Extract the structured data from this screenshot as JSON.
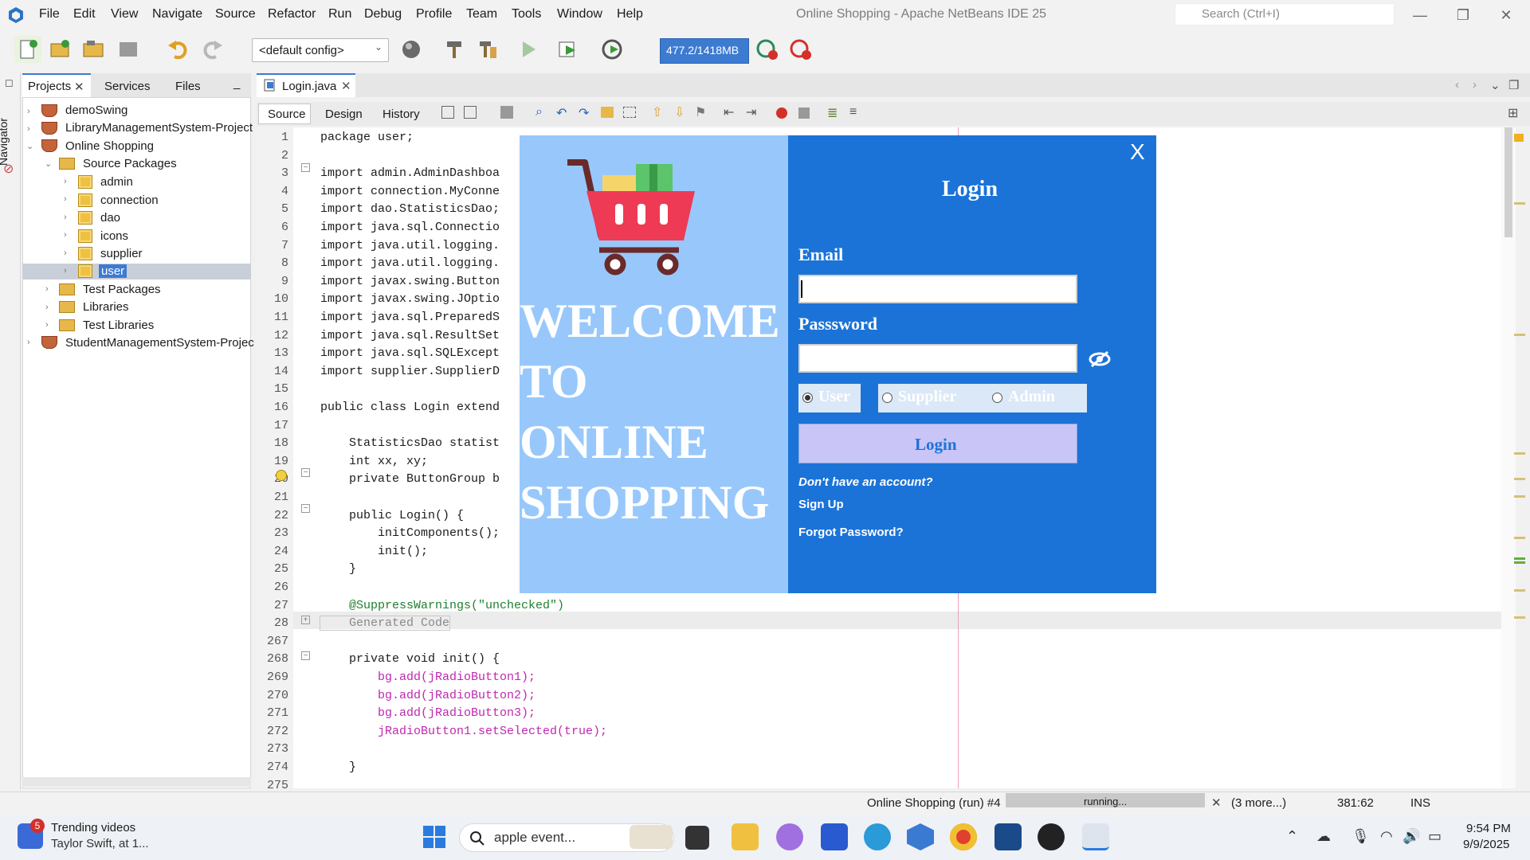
{
  "window": {
    "title": "Online Shopping - Apache NetBeans IDE 25",
    "search_placeholder": "Search (Ctrl+I)"
  },
  "menu": [
    "File",
    "Edit",
    "View",
    "Navigate",
    "Source",
    "Refactor",
    "Run",
    "Debug",
    "Profile",
    "Team",
    "Tools",
    "Window",
    "Help"
  ],
  "toolbar": {
    "config": "<default config>",
    "memory": "477.2/1418MB"
  },
  "side_tabs": {
    "projects": "Projects",
    "services": "Services",
    "files": "Files",
    "navigator": "Navigator"
  },
  "tree": [
    "demoSwing",
    "LibraryManagementSystem-Project",
    "Online Shopping",
    "Source Packages",
    "admin",
    "connection",
    "dao",
    "icons",
    "supplier",
    "user",
    "Test Packages",
    "Libraries",
    "Test Libraries",
    "StudentManagementSystem-Projec"
  ],
  "editor": {
    "tab": "Login.java",
    "views": [
      "Source",
      "Design",
      "History"
    ],
    "lines": [
      {
        "n": "1",
        "code": "package user;"
      },
      {
        "n": "2",
        "code": ""
      },
      {
        "n": "3",
        "code": "import admin.AdminDashboa"
      },
      {
        "n": "4",
        "code": "import connection.MyConne"
      },
      {
        "n": "5",
        "code": "import dao.StatisticsDao;"
      },
      {
        "n": "6",
        "code": "import java.sql.Connectio"
      },
      {
        "n": "7",
        "code": "import java.util.logging."
      },
      {
        "n": "8",
        "code": "import java.util.logging."
      },
      {
        "n": "9",
        "code": "import javax.swing.Button"
      },
      {
        "n": "10",
        "code": "import javax.swing.JOptio"
      },
      {
        "n": "11",
        "code": "import java.sql.PreparedS"
      },
      {
        "n": "12",
        "code": "import java.sql.ResultSet"
      },
      {
        "n": "13",
        "code": "import java.sql.SQLExcept"
      },
      {
        "n": "14",
        "code": "import supplier.SupplierD"
      },
      {
        "n": "15",
        "code": ""
      },
      {
        "n": "16",
        "code": "public class Login extend"
      },
      {
        "n": "17",
        "code": ""
      },
      {
        "n": "18",
        "code": "    StatisticsDao statist"
      },
      {
        "n": "19",
        "code": "    int xx, xy;"
      },
      {
        "n": "20",
        "code": "    private ButtonGroup b"
      },
      {
        "n": "21",
        "code": ""
      },
      {
        "n": "22",
        "code": "    public Login() {"
      },
      {
        "n": "23",
        "code": "        initComponents();"
      },
      {
        "n": "24",
        "code": "        init();"
      },
      {
        "n": "25",
        "code": "    }"
      },
      {
        "n": "26",
        "code": ""
      },
      {
        "n": "27",
        "code": "    @SuppressWarnings(\"unchecked\")"
      },
      {
        "n": "28",
        "code": "    Generated Code"
      },
      {
        "n": "267",
        "code": ""
      },
      {
        "n": "268",
        "code": "    private void init() {"
      },
      {
        "n": "269",
        "code": "        bg.add(jRadioButton1);"
      },
      {
        "n": "270",
        "code": "        bg.add(jRadioButton2);"
      },
      {
        "n": "271",
        "code": "        bg.add(jRadioButton3);"
      },
      {
        "n": "272",
        "code": "        jRadioButton1.setSelected(true);"
      },
      {
        "n": "273",
        "code": ""
      },
      {
        "n": "274",
        "code": "    }"
      },
      {
        "n": "275",
        "code": ""
      }
    ]
  },
  "dialog": {
    "welcome": "WELCOME\nTO\nONLINE\nSHOPPING",
    "close": "X",
    "title": "Login",
    "email_label": "Email",
    "password_label": "Passsword",
    "roles": [
      "User",
      "Supplier",
      "Admin"
    ],
    "selected_role": "User",
    "login_button": "Login",
    "no_account": "Don't have an account?",
    "sign_up": "Sign Up",
    "forgot": "Forgot Password?",
    "colors": {
      "left_panel": "#98c8fb",
      "right_panel": "#1b73d8",
      "button": "#c9c5f7"
    }
  },
  "status": {
    "run": "Online Shopping (run) #4",
    "progress": "running...",
    "more": "(3 more...)",
    "position": "381:62",
    "mode": "INS"
  },
  "taskbar": {
    "news_title": "Trending videos",
    "news_sub": "Taylor Swift, at 1...",
    "badge": "5",
    "search": "apple event...",
    "time": "9:54 PM",
    "date": "9/9/2025"
  }
}
